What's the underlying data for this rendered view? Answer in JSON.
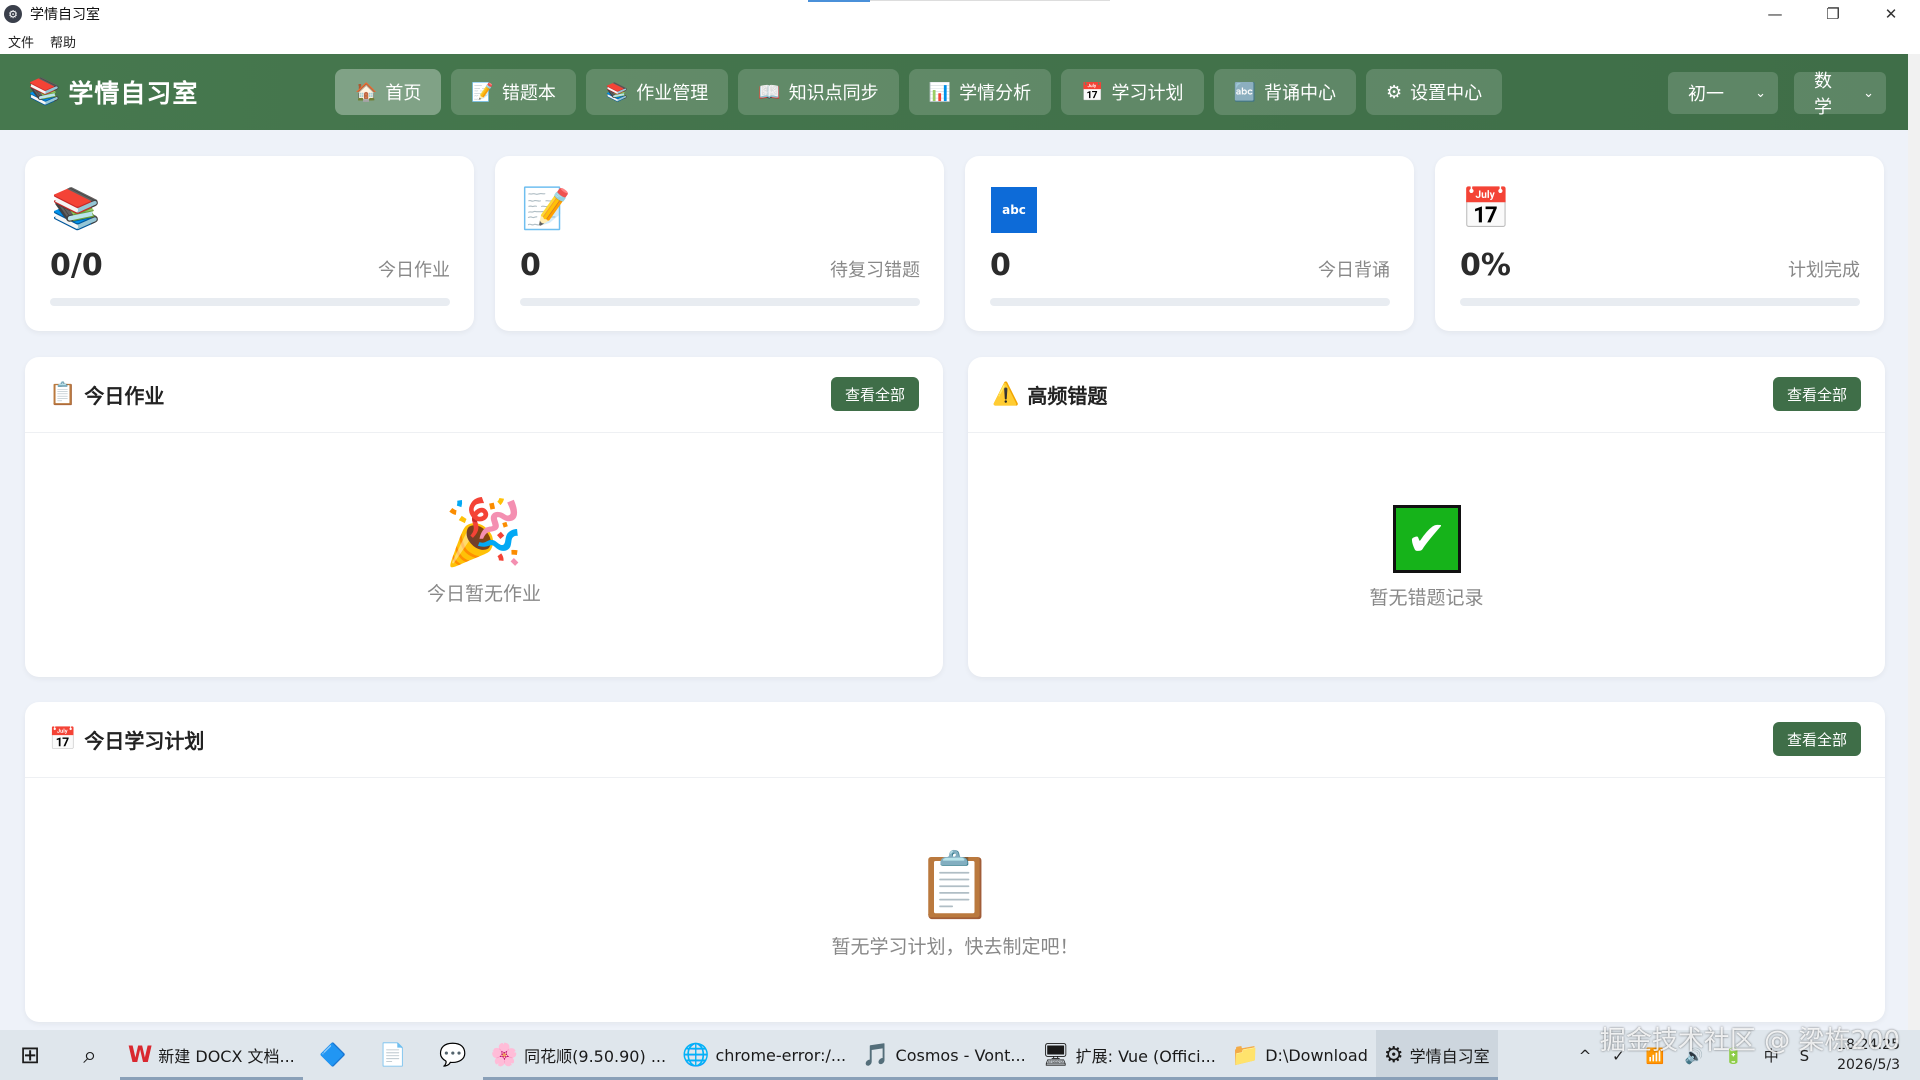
{
  "window": {
    "title": "学情自习室",
    "controls": [
      "—",
      "❐",
      "✕"
    ]
  },
  "menubar": [
    "文件",
    "帮助"
  ],
  "header": {
    "brand": "学情自习室",
    "nav": [
      {
        "icon": "home-icon",
        "glyph": "🏠",
        "label": "首页",
        "active": true
      },
      {
        "icon": "notebook-icon",
        "glyph": "📝",
        "label": "错题本",
        "active": false
      },
      {
        "icon": "books-icon",
        "glyph": "📚",
        "label": "作业管理",
        "active": false
      },
      {
        "icon": "book-icon",
        "glyph": "📖",
        "label": "知识点同步",
        "active": false
      },
      {
        "icon": "chart-icon",
        "glyph": "📊",
        "label": "学情分析",
        "active": false
      },
      {
        "icon": "calendar-icon",
        "glyph": "📅",
        "label": "学习计划",
        "active": false
      },
      {
        "icon": "abc-icon",
        "glyph": "🔤",
        "label": "背诵中心",
        "active": false
      },
      {
        "icon": "gear-icon",
        "glyph": "⚙",
        "label": "设置中心",
        "active": false
      }
    ],
    "grade": "初一",
    "subject": "数学"
  },
  "stats": [
    {
      "icon": "books-icon",
      "glyph": "📚",
      "value": "0/0",
      "label": "今日作业",
      "progress": 0
    },
    {
      "icon": "memo-icon",
      "glyph": "📝",
      "value": "0",
      "label": "待复习错题",
      "progress": 0
    },
    {
      "icon": "abc-icon",
      "glyph": "abc",
      "value": "0",
      "label": "今日背诵",
      "progress": 0
    },
    {
      "icon": "calendar-icon",
      "glyph": "📅",
      "value": "0%",
      "label": "计划完成",
      "progress": 0
    }
  ],
  "panels": {
    "homework": {
      "icon": "clipboard-icon",
      "glyph": "📋",
      "title": "今日作业",
      "button": "查看全部",
      "empty_glyph": "🎉",
      "empty_text": "今日暂无作业"
    },
    "mistakes": {
      "icon": "warning-icon",
      "glyph": "⚠️",
      "title": "高频错题",
      "button": "查看全部",
      "empty_glyph": "✔",
      "empty_text": "暂无错题记录"
    },
    "plan": {
      "icon": "calendar-icon",
      "glyph": "📅",
      "title": "今日学习计划",
      "button": "查看全部",
      "empty_glyph": "📋",
      "empty_text": "暂无学习计划，快去制定吧！"
    }
  },
  "taskbar": {
    "items": [
      {
        "icon": "wps-icon",
        "glyph": "W",
        "label": "新建 DOCX 文档..."
      },
      {
        "icon": "feishu-icon",
        "glyph": "🔷",
        "label": ""
      },
      {
        "icon": "file-icon",
        "glyph": "📄",
        "label": ""
      },
      {
        "icon": "wechat-icon",
        "glyph": "💬",
        "label": ""
      },
      {
        "icon": "tonghuashun-icon",
        "glyph": "🌸",
        "label": "同花顺(9.50.90) ..."
      },
      {
        "icon": "chrome-icon",
        "glyph": "🌐",
        "label": "chrome-error:/..."
      },
      {
        "icon": "netease-music-icon",
        "glyph": "🎵",
        "label": "Cosmos - Vont..."
      },
      {
        "icon": "vscode-icon",
        "glyph": "🖥",
        "label": "扩展: Vue (Offici..."
      },
      {
        "icon": "folder-icon",
        "glyph": "📁",
        "label": "D:\\Download"
      },
      {
        "icon": "app-icon",
        "glyph": "⚙",
        "label": "学情自习室",
        "active": true
      }
    ],
    "tray": "^ ✓ 📶 🔊 🔋 中 S",
    "time": "18:24:25",
    "date": "2026/5/3"
  },
  "watermark": "掘金技术社区 @ 梁栋200"
}
